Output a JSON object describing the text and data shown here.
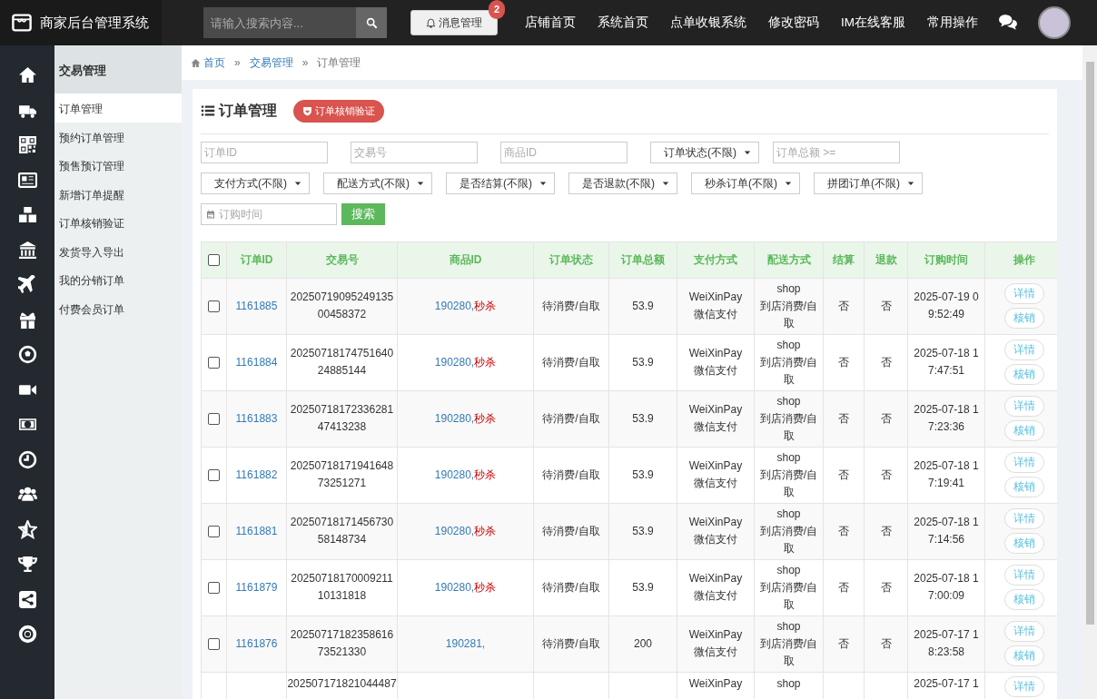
{
  "header": {
    "brand": "商家后台管理系统",
    "search": {
      "placeholder": "请输入搜索内容..."
    },
    "message_button": {
      "label": "消息管理",
      "badge": "2"
    },
    "links": [
      "店铺首页",
      "系统首页",
      "点单收银系统",
      "修改密码",
      "IM在线客服",
      "常用操作"
    ]
  },
  "submenu": {
    "title": "交易管理",
    "items": [
      {
        "label": "订单管理",
        "selected": true
      },
      {
        "label": "预约订单管理",
        "selected": false
      },
      {
        "label": "预售预订管理",
        "selected": false
      },
      {
        "label": "新增订单提醒",
        "selected": false
      },
      {
        "label": "订单核销验证",
        "selected": false
      },
      {
        "label": "发货导入导出",
        "selected": false
      },
      {
        "label": "我的分销订单",
        "selected": false
      },
      {
        "label": "付费会员订单",
        "selected": false
      }
    ]
  },
  "breadcrumb": {
    "items": [
      "首页",
      "交易管理",
      "订单管理"
    ],
    "separator": "»"
  },
  "panel": {
    "title": "订单管理",
    "verify_button": "订单核销验证"
  },
  "filters": [
    {
      "kind": "input",
      "placeholder": "订单ID"
    },
    {
      "kind": "input",
      "placeholder": "交易号"
    },
    {
      "kind": "input",
      "placeholder": "商品ID"
    },
    {
      "kind": "select",
      "label": "订单状态(不限)"
    },
    {
      "kind": "input",
      "placeholder": "订单总额 >="
    },
    {
      "kind": "select",
      "label": "支付方式(不限)"
    },
    {
      "kind": "select",
      "label": "配送方式(不限)"
    },
    {
      "kind": "select",
      "label": "是否结算(不限)"
    },
    {
      "kind": "select",
      "label": "是否退款(不限)"
    },
    {
      "kind": "select",
      "label": "秒杀订单(不限)"
    },
    {
      "kind": "select",
      "label": "拼团订单(不限)"
    },
    {
      "kind": "date",
      "placeholder": "订购时间"
    },
    {
      "kind": "button",
      "label": "搜索"
    }
  ],
  "table": {
    "columns": [
      "订单ID",
      "交易号",
      "商品ID",
      "订单状态",
      "订单总额",
      "支付方式",
      "配送方式",
      "结算",
      "退款",
      "订购时间",
      "操作"
    ],
    "header_checked": false,
    "rows": [
      {
        "checked": false,
        "id": "1161885",
        "trade_no": "2025071909524913500458372",
        "goods": "190280,",
        "tag": "秒杀",
        "status": "待消费/自取",
        "total": "53.9",
        "pay": [
          "WeiXinPay",
          "微信支付"
        ],
        "delivery": [
          "shop",
          "到店消费/自取"
        ],
        "settled": "否",
        "refunded": "否",
        "time": "2025-07-19 09:52:49",
        "actions": [
          "详情",
          "核销"
        ]
      },
      {
        "checked": false,
        "id": "1161884",
        "trade_no": "2025071817475164024885144",
        "goods": "190280,",
        "tag": "秒杀",
        "status": "待消费/自取",
        "total": "53.9",
        "pay": [
          "WeiXinPay",
          "微信支付"
        ],
        "delivery": [
          "shop",
          "到店消费/自取"
        ],
        "settled": "否",
        "refunded": "否",
        "time": "2025-07-18 17:47:51",
        "actions": [
          "详情",
          "核销"
        ]
      },
      {
        "checked": false,
        "id": "1161883",
        "trade_no": "2025071817233628147413238",
        "goods": "190280,",
        "tag": "秒杀",
        "status": "待消费/自取",
        "total": "53.9",
        "pay": [
          "WeiXinPay",
          "微信支付"
        ],
        "delivery": [
          "shop",
          "到店消费/自取"
        ],
        "settled": "否",
        "refunded": "否",
        "time": "2025-07-18 17:23:36",
        "actions": [
          "详情",
          "核销"
        ]
      },
      {
        "checked": false,
        "id": "1161882",
        "trade_no": "2025071817194164873251271",
        "goods": "190280,",
        "tag": "秒杀",
        "status": "待消费/自取",
        "total": "53.9",
        "pay": [
          "WeiXinPay",
          "微信支付"
        ],
        "delivery": [
          "shop",
          "到店消费/自取"
        ],
        "settled": "否",
        "refunded": "否",
        "time": "2025-07-18 17:19:41",
        "actions": [
          "详情",
          "核销"
        ]
      },
      {
        "checked": false,
        "id": "1161881",
        "trade_no": "2025071817145673058148734",
        "goods": "190280,",
        "tag": "秒杀",
        "status": "待消费/自取",
        "total": "53.9",
        "pay": [
          "WeiXinPay",
          "微信支付"
        ],
        "delivery": [
          "shop",
          "到店消费/自取"
        ],
        "settled": "否",
        "refunded": "否",
        "time": "2025-07-18 17:14:56",
        "actions": [
          "详情",
          "核销"
        ]
      },
      {
        "checked": false,
        "id": "1161879",
        "trade_no": "2025071817000921110131818",
        "goods": "190280,",
        "tag": "秒杀",
        "status": "待消费/自取",
        "total": "53.9",
        "pay": [
          "WeiXinPay",
          "微信支付"
        ],
        "delivery": [
          "shop",
          "到店消费/自取"
        ],
        "settled": "否",
        "refunded": "否",
        "time": "2025-07-18 17:00:09",
        "actions": [
          "详情",
          "核销"
        ]
      },
      {
        "checked": false,
        "id": "1161876",
        "trade_no": "2025071718235861673521330",
        "goods": "190281,",
        "status": "待消费/自取",
        "total": "200",
        "pay": [
          "WeiXinPay",
          "微信支付"
        ],
        "delivery": [
          "shop",
          "到店消费/自取"
        ],
        "settled": "否",
        "refunded": "否",
        "time": "2025-07-17 18:23:58",
        "actions": [
          "详情",
          "核销"
        ]
      }
    ],
    "partial_row": {
      "trade_no": "202507171821044487",
      "pay": "WeiXinPay",
      "delivery": "shop",
      "time": "2025-07-17 1",
      "action": "详情"
    }
  }
}
